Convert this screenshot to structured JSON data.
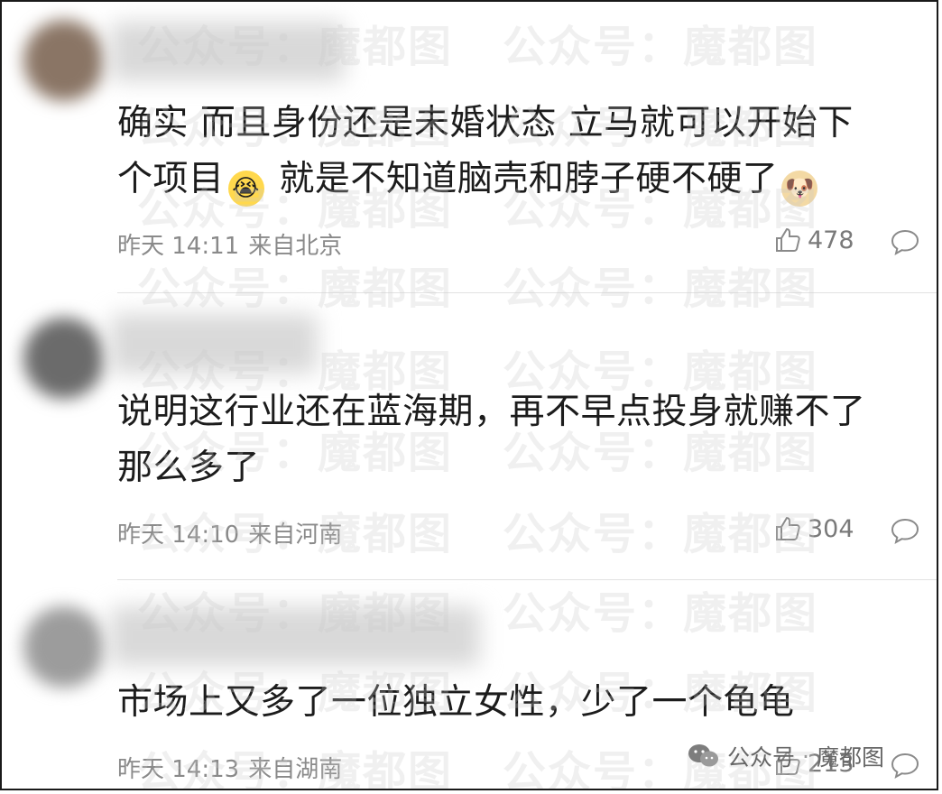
{
  "comments": [
    {
      "text_line1": "确实 而且身份还是未婚状态 立马就可以开始下",
      "text_line2a": "个项目",
      "emoji1": "😭",
      "text_line2b": " 就是不知道脑壳和脖子硬不硬了",
      "emoji2": "🐶",
      "time": "昨天 14:11",
      "location": "来自北京",
      "likes": "478"
    },
    {
      "text_line1": "说明这行业还在蓝海期，再不早点投身就赚不了",
      "text_line2": "那么多了",
      "time": "昨天 14:10",
      "location": "来自河南",
      "likes": "304"
    },
    {
      "text_line1": "市场上又多了一位独立女性，少了一个龟龟",
      "time": "昨天 14:13",
      "location": "来自湖南",
      "likes": "213"
    }
  ],
  "watermark": {
    "label": "公众号：",
    "brand": "魔都图"
  },
  "corner_watermark": {
    "label": "公众号",
    "separator": "·",
    "brand": "魔都图"
  },
  "colors": {
    "avatar1": "#8a7565",
    "avatar2": "#6b6b6b",
    "avatar3": "#9c9c9c"
  }
}
